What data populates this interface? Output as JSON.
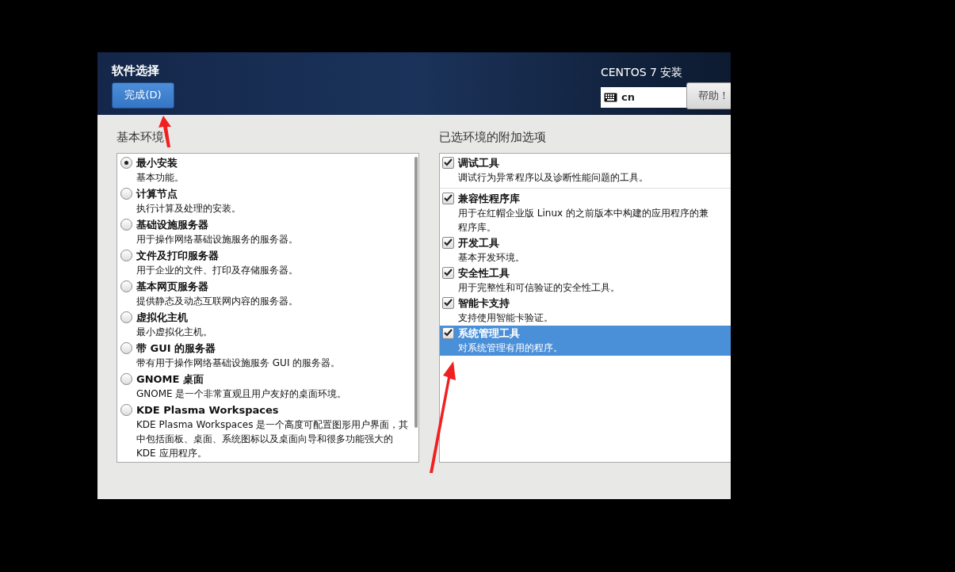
{
  "header": {
    "title": "软件选择",
    "done_button": "完成(D)",
    "product": "CENTOS 7 安装",
    "keyboard_layout": "cn",
    "help_button": "帮助！"
  },
  "environments": {
    "heading": "基本环境",
    "items": [
      {
        "name": "最小安装",
        "description": "基本功能。",
        "selected": true
      },
      {
        "name": "计算节点",
        "description": "执行计算及处理的安装。",
        "selected": false
      },
      {
        "name": "基础设施服务器",
        "description": "用于操作网络基础设施服务的服务器。",
        "selected": false
      },
      {
        "name": "文件及打印服务器",
        "description": "用于企业的文件、打印及存储服务器。",
        "selected": false
      },
      {
        "name": "基本网页服务器",
        "description": "提供静态及动态互联网内容的服务器。",
        "selected": false
      },
      {
        "name": "虚拟化主机",
        "description": "最小虚拟化主机。",
        "selected": false
      },
      {
        "name": "带 GUI 的服务器",
        "description": "带有用于操作网络基础设施服务 GUI 的服务器。",
        "selected": false
      },
      {
        "name": "GNOME 桌面",
        "description": "GNOME 是一个非常直观且用户友好的桌面环境。",
        "selected": false
      },
      {
        "name": "KDE Plasma Workspaces",
        "description": "KDE Plasma Workspaces 是一个高度可配置图形用户界面，其中包括面板、桌面、系统图标以及桌面向导和很多功能强大的 KDE 应用程序。",
        "selected": false
      }
    ]
  },
  "addons": {
    "heading": "已选环境的附加选项",
    "items": [
      {
        "name": "调试工具",
        "description_lines": [
          "调试行为异常程序以及诊断性能问题的工具。"
        ],
        "checked": true,
        "selected": false
      },
      {
        "name": "兼容性程序库",
        "description_lines": [
          "用于在红帽企业版 Linux 的之前版本中构建的应用程序的兼",
          "程序库。"
        ],
        "checked": true,
        "selected": false
      },
      {
        "name": "开发工具",
        "description_lines": [
          "基本开发环境。"
        ],
        "checked": true,
        "selected": false
      },
      {
        "name": "安全性工具",
        "description_lines": [
          "用于完整性和可信验证的安全性工具。"
        ],
        "checked": true,
        "selected": false
      },
      {
        "name": "智能卡支持",
        "description_lines": [
          "支持使用智能卡验证。"
        ],
        "checked": true,
        "selected": false
      },
      {
        "name": "系统管理工具",
        "description_lines": [
          "对系统管理有用的程序。"
        ],
        "checked": true,
        "selected": true
      }
    ]
  }
}
